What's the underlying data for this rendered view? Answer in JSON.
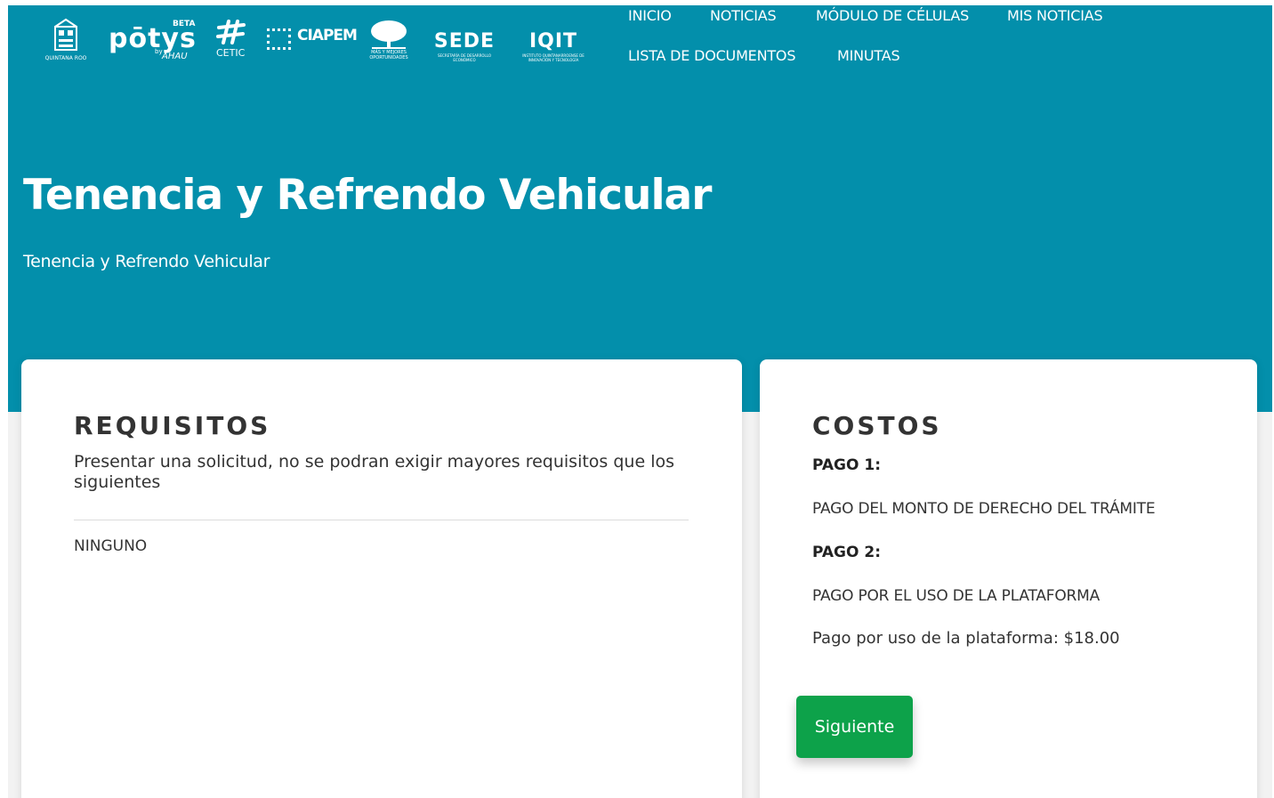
{
  "logos": {
    "qroo_text": "QUINTANA ROO",
    "potys_text": "pōtys",
    "potys_beta": "BETA",
    "potys_by": "by",
    "potys_brand": "AHAU",
    "cetic_text": "CETIC",
    "ciapem_text": "CIAPEM",
    "mmo_text": "MÁS Y MEJORES OPORTUNIDADES",
    "sede_text": "SEDE",
    "sede_sub": "SECRETARÍA DE DESARROLLO ECONÓMICO",
    "iqit_text": "IQIT",
    "iqit_sub": "INSTITUTO QUINTANARROENSE DE INNOVACIÓN Y TECNOLOGÍA"
  },
  "nav": {
    "inicio": "INICIO",
    "noticias": "NOTICIAS",
    "modulo": "MÓDULO DE CÉLULAS",
    "mis_noticias": "MIS NOTICIAS",
    "lista": "LISTA DE DOCUMENTOS",
    "minutas": "MINUTAS"
  },
  "hero": {
    "title": "Tenencia y Refrendo Vehicular",
    "subtitle": "Tenencia y Refrendo Vehicular"
  },
  "requisitos": {
    "heading": "REQUISITOS",
    "description": "Presentar una solicitud, no se podran exigir mayores requisitos que los siguientes",
    "item": "NINGUNO"
  },
  "costos": {
    "heading": "COSTOS",
    "pago1_label": "PAGO 1:",
    "pago1_desc": "PAGO DEL MONTO DE DERECHO DEL TRÁMITE",
    "pago2_label": "PAGO 2:",
    "pago2_desc": "PAGO POR EL USO DE LA PLATAFORMA",
    "fee": "Pago por uso de la plataforma: $18.00",
    "next_label": "Siguiente"
  },
  "colors": {
    "hero_bg": "#038fab",
    "button_bg": "#0da24a"
  }
}
